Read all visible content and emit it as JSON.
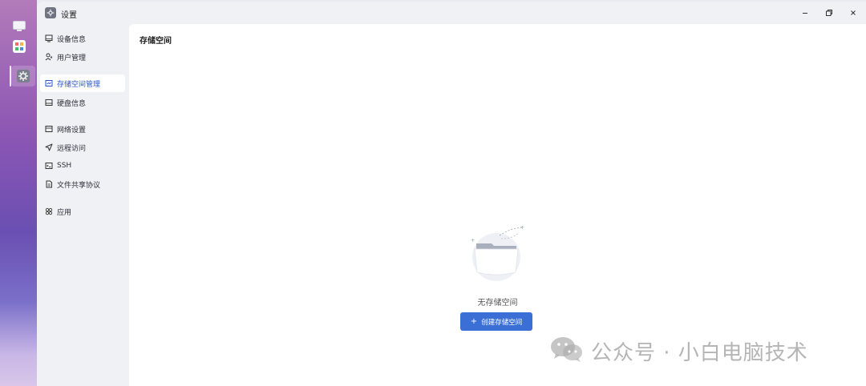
{
  "window": {
    "title": "设置"
  },
  "sidebar": {
    "items": [
      {
        "label": "设备信息",
        "icon": "monitor-icon"
      },
      {
        "label": "用户管理",
        "icon": "users-icon"
      },
      {
        "label": "存储空间管理",
        "icon": "storage-icon",
        "active": true
      },
      {
        "label": "硬盘信息",
        "icon": "disk-icon"
      },
      {
        "label": "网络设置",
        "icon": "network-icon"
      },
      {
        "label": "远程访问",
        "icon": "send-icon"
      },
      {
        "label": "SSH",
        "icon": "terminal-icon"
      },
      {
        "label": "文件共享协议",
        "icon": "file-icon"
      },
      {
        "label": "应用",
        "icon": "apps-icon"
      }
    ]
  },
  "main": {
    "title": "存储空间",
    "empty_text": "无存储空间",
    "create_button_label": "创建存储空间"
  },
  "watermark": {
    "text": "公众号 · 小白电脑技术"
  },
  "colors": {
    "accent": "#3b6fd6",
    "active_text": "#2a55c9"
  }
}
